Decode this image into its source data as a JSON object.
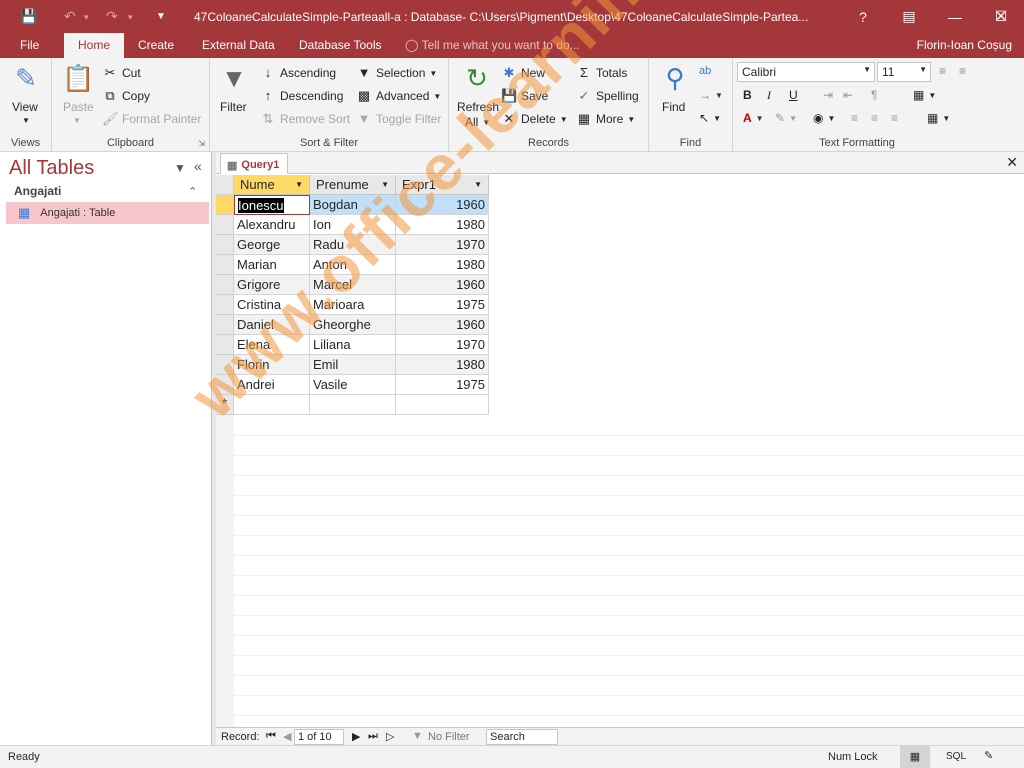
{
  "titlebar": {
    "title": "47ColoaneCalculateSimple-Parteaall-a : Database- C:\\Users\\Pigment\\Desktop\\47ColoaneCalculateSimple-Partea...",
    "help": "?"
  },
  "tabs": [
    "File",
    "Home",
    "Create",
    "External Data",
    "Database Tools"
  ],
  "tell_me": "Tell me what you want to do...",
  "user": "Florin-Ioan Coșug",
  "ribbon": {
    "views": {
      "label": "Views",
      "view": "View"
    },
    "clipboard": {
      "label": "Clipboard",
      "paste": "Paste",
      "cut": "Cut",
      "copy": "Copy",
      "format_painter": "Format Painter"
    },
    "sort_filter": {
      "label": "Sort & Filter",
      "filter": "Filter",
      "ascending": "Ascending",
      "descending": "Descending",
      "remove_sort": "Remove Sort",
      "selection": "Selection",
      "advanced": "Advanced",
      "toggle_filter": "Toggle Filter"
    },
    "records": {
      "label": "Records",
      "refresh": "Refresh",
      "refresh_all": "All",
      "new": "New",
      "save": "Save",
      "delete": "Delete",
      "totals": "Totals",
      "spelling": "Spelling",
      "more": "More"
    },
    "find": {
      "label": "Find",
      "find": "Find"
    },
    "text_formatting": {
      "label": "Text Formatting",
      "font": "Calibri",
      "size": "11"
    }
  },
  "nav": {
    "title": "All Tables",
    "group": "Angajati",
    "item": "Angajati : Table"
  },
  "document": {
    "tab": "Query1"
  },
  "grid": {
    "columns": [
      "Nume",
      "Prenume",
      "Expr1"
    ],
    "rows": [
      [
        "Ionescu",
        "Bogdan",
        "1960"
      ],
      [
        "Alexandru",
        "Ion",
        "1980"
      ],
      [
        "George",
        "Radu",
        "1970"
      ],
      [
        "Marian",
        "Anton",
        "1980"
      ],
      [
        "Grigore",
        "Marcel",
        "1960"
      ],
      [
        "Cristina",
        "Marioara",
        "1975"
      ],
      [
        "Daniel",
        "Gheorghe",
        "1960"
      ],
      [
        "Elena",
        "Liliana",
        "1970"
      ],
      [
        "Florin",
        "Emil",
        "1980"
      ],
      [
        "Andrei",
        "Vasile",
        "1975"
      ]
    ],
    "new_row_marker": "*"
  },
  "record_nav": {
    "label": "Record:",
    "position": "1 of 10",
    "filter": "No Filter",
    "search": "Search"
  },
  "status": {
    "left": "Ready",
    "num_lock": "Num Lock",
    "sql": "SQL"
  },
  "watermark": "www.office-learning.ro",
  "colors": {
    "accent": "#a4373a",
    "selected_row": "#bfe0f8",
    "header_active": "#ffd966"
  }
}
